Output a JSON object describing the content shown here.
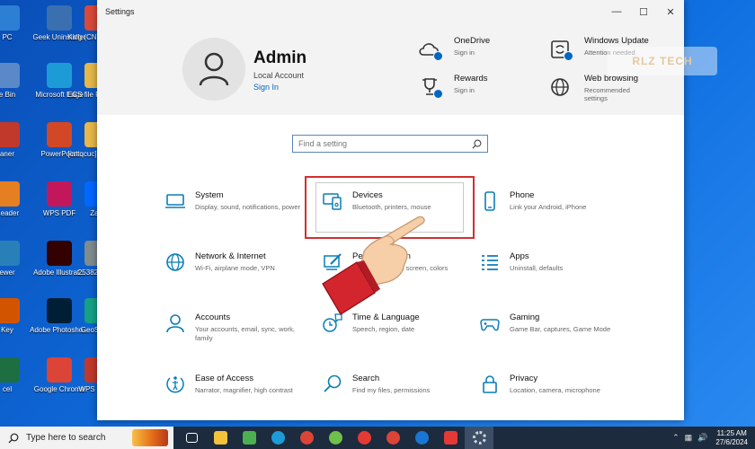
{
  "window": {
    "title": "Settings",
    "minimize": "—",
    "maximize": "☐",
    "close": "✕"
  },
  "account": {
    "name": "Admin",
    "type": "Local Account",
    "sign_in": "Sign In"
  },
  "header_items": [
    {
      "title": "OneDrive",
      "sub": "Sign in",
      "icon": "cloud-icon"
    },
    {
      "title": "Windows Update",
      "sub": "Attention needed",
      "icon": "update-icon"
    },
    {
      "title": "Rewards",
      "sub": "Sign in",
      "icon": "trophy-icon"
    },
    {
      "title": "Web browsing",
      "sub": "Recommended settings",
      "icon": "globe-icon"
    }
  ],
  "watermark": "RLZ TECH",
  "search": {
    "placeholder": "Find a setting"
  },
  "tiles": [
    {
      "title": "System",
      "sub": "Display, sound, notifications, power",
      "icon": "laptop-icon"
    },
    {
      "title": "Devices",
      "sub": "Bluetooth, printers, mouse",
      "icon": "devices-icon"
    },
    {
      "title": "Phone",
      "sub": "Link your Android, iPhone",
      "icon": "phone-icon"
    },
    {
      "title": "Network & Internet",
      "sub": "Wi-Fi, airplane mode, VPN",
      "icon": "globe-icon"
    },
    {
      "title": "Personalization",
      "sub": "Background, lock screen, colors",
      "icon": "paint-icon"
    },
    {
      "title": "Apps",
      "sub": "Uninstall, defaults",
      "icon": "apps-list-icon"
    },
    {
      "title": "Accounts",
      "sub": "Your accounts, email, sync, work, family",
      "icon": "person-icon"
    },
    {
      "title": "Time & Language",
      "sub": "Speech, region, date",
      "icon": "time-language-icon"
    },
    {
      "title": "Gaming",
      "sub": "Game Bar, captures, Game Mode",
      "icon": "gamepad-icon"
    },
    {
      "title": "Ease of Access",
      "sub": "Narrator, magnifier, high contrast",
      "icon": "ease-of-access-icon"
    },
    {
      "title": "Search",
      "sub": "Find my files, permissions",
      "icon": "search-icon"
    },
    {
      "title": "Privacy",
      "sub": "Location, camera, microphone",
      "icon": "lock-icon"
    }
  ],
  "desktop_icons": [
    {
      "label": "PC",
      "color": "#2d7fd3"
    },
    {
      "label": "Geek Uninstaller",
      "color": "#3a6fb0"
    },
    {
      "label": "King (CN) Chrome",
      "color": "#d84a3a"
    },
    {
      "label": "e Bin",
      "color": "#5a88c8"
    },
    {
      "label": "Microsoft Edge",
      "color": "#1d9bd7"
    },
    {
      "label": "ECS file FPL HCM",
      "color": "#e6b84a"
    },
    {
      "label": "aner",
      "color": "#c0392b"
    },
    {
      "label": "PowerPoint",
      "color": "#d24726"
    },
    {
      "label": "[cntqcuc] Adobe Ill",
      "color": "#e6b84a"
    },
    {
      "label": "Reader",
      "color": "#e67e22"
    },
    {
      "label": "WPS PDF",
      "color": "#c2185b"
    },
    {
      "label": "Zalo",
      "color": "#0068ff"
    },
    {
      "label": "ewer",
      "color": "#2980b9"
    },
    {
      "label": "Adobe Illustrat...",
      "color": "#330000"
    },
    {
      "label": "25382460...",
      "color": "#7f8c8d"
    },
    {
      "label": "Key",
      "color": "#d35400"
    },
    {
      "label": "Adobe Photosho...",
      "color": "#001e36"
    },
    {
      "label": "GeoSetter",
      "color": "#16a085"
    },
    {
      "label": "cel",
      "color": "#1d6f42"
    },
    {
      "label": "Google Chrome",
      "color": "#db4437"
    },
    {
      "label": "WPS Office",
      "color": "#c0392b"
    }
  ],
  "taskbar": {
    "search_text": "Type here to search",
    "apps": [
      {
        "name": "task-view-icon",
        "color": "#ffffff"
      },
      {
        "name": "file-explorer-icon",
        "color": "#f3c13a"
      },
      {
        "name": "store-icon",
        "color": "#4caf50"
      },
      {
        "name": "edge-icon",
        "color": "#1d9bd7"
      },
      {
        "name": "chrome-icon",
        "color": "#db4437"
      },
      {
        "name": "coccoc-icon",
        "color": "#6fbf4a"
      },
      {
        "name": "opera-icon",
        "color": "#e53935"
      },
      {
        "name": "chrome-icon",
        "color": "#db4437"
      },
      {
        "name": "chrome-icon",
        "color": "#1976d2"
      },
      {
        "name": "wps-icon",
        "color": "#e53935"
      },
      {
        "name": "settings-icon",
        "color": "#cfd8dc"
      }
    ],
    "time": "11:25 AM",
    "date": "27/6/2024"
  }
}
